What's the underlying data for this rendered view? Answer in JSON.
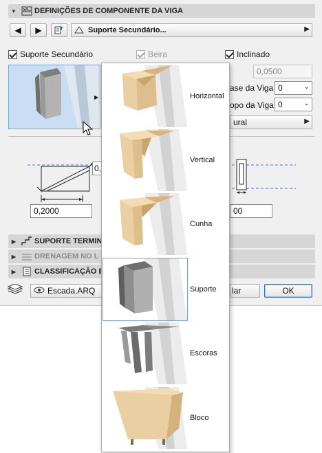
{
  "header": {
    "title": "DEFINIÇÕES DE COMPONENTE DA VIGA"
  },
  "toolbar": {
    "profile_name": "Suporte Secundário..."
  },
  "options": {
    "secondary_support_label": "Suporte Secundário",
    "secondary_support_checked": true,
    "edge_label": "Beira",
    "edge_checked": true,
    "inclined_label": "Inclinado",
    "inclined_checked": true
  },
  "fields": {
    "offset_value": "0,0500",
    "base_label": "ase da Viga",
    "base_value": "0",
    "top_label": "opo da Viga",
    "top_value": "0",
    "structural_label": "ural",
    "dim_left_value": "0,2000",
    "dim_top_value": "0,",
    "dim_right_value": "00"
  },
  "sections": [
    {
      "label": "SUPORTE TERMIN",
      "dimmed": false
    },
    {
      "label": "DRENAGEM NO L",
      "dimmed": true
    },
    {
      "label": "CLASSIFICAÇÃO E",
      "dimmed": false
    }
  ],
  "footer": {
    "layer_value": "Escada.ARQ",
    "cancel_label": "lar",
    "ok_label": "OK"
  },
  "popup": {
    "items": [
      {
        "label": "Horizontal",
        "selected": false
      },
      {
        "label": "Vertical",
        "selected": false
      },
      {
        "label": "Cunha",
        "selected": false
      },
      {
        "label": "Suporte",
        "selected": true
      },
      {
        "label": "Escoras",
        "selected": false
      },
      {
        "label": "Bloco",
        "selected": false
      }
    ]
  },
  "colors": {
    "wood": "#e9cfa1",
    "wood_dark": "#c9a46c",
    "metal": "#9b9b9b",
    "preview_bg": "#c9def3",
    "accent": "#1f6fd0"
  }
}
